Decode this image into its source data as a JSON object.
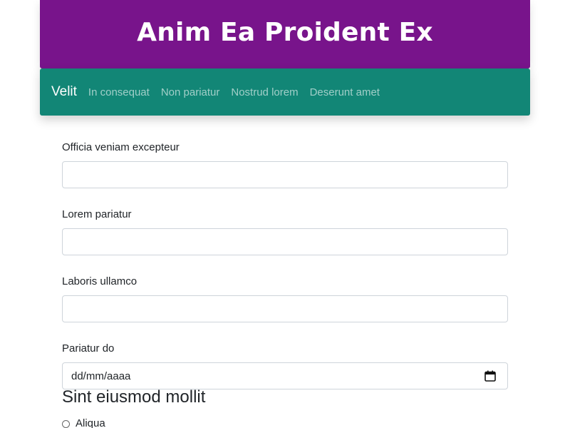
{
  "header": {
    "title": "Anim Ea Proident Ex"
  },
  "navbar": {
    "brand": "Velit",
    "links": [
      "In consequat",
      "Non pariatur",
      "Nostrud lorem",
      "Deserunt amet"
    ]
  },
  "form": {
    "fields": [
      {
        "label": "Officia veniam excepteur",
        "value": ""
      },
      {
        "label": "Lorem pariatur",
        "value": ""
      },
      {
        "label": "Laboris ullamco",
        "value": ""
      }
    ],
    "date_field": {
      "label": "Pariatur do",
      "placeholder": "dd/mm/aaaa"
    },
    "section_title": "Sint eiusmod mollit",
    "radio_options": [
      "Aliqua"
    ]
  },
  "colors": {
    "header_bg": "#78148b",
    "navbar_bg": "#128676"
  }
}
